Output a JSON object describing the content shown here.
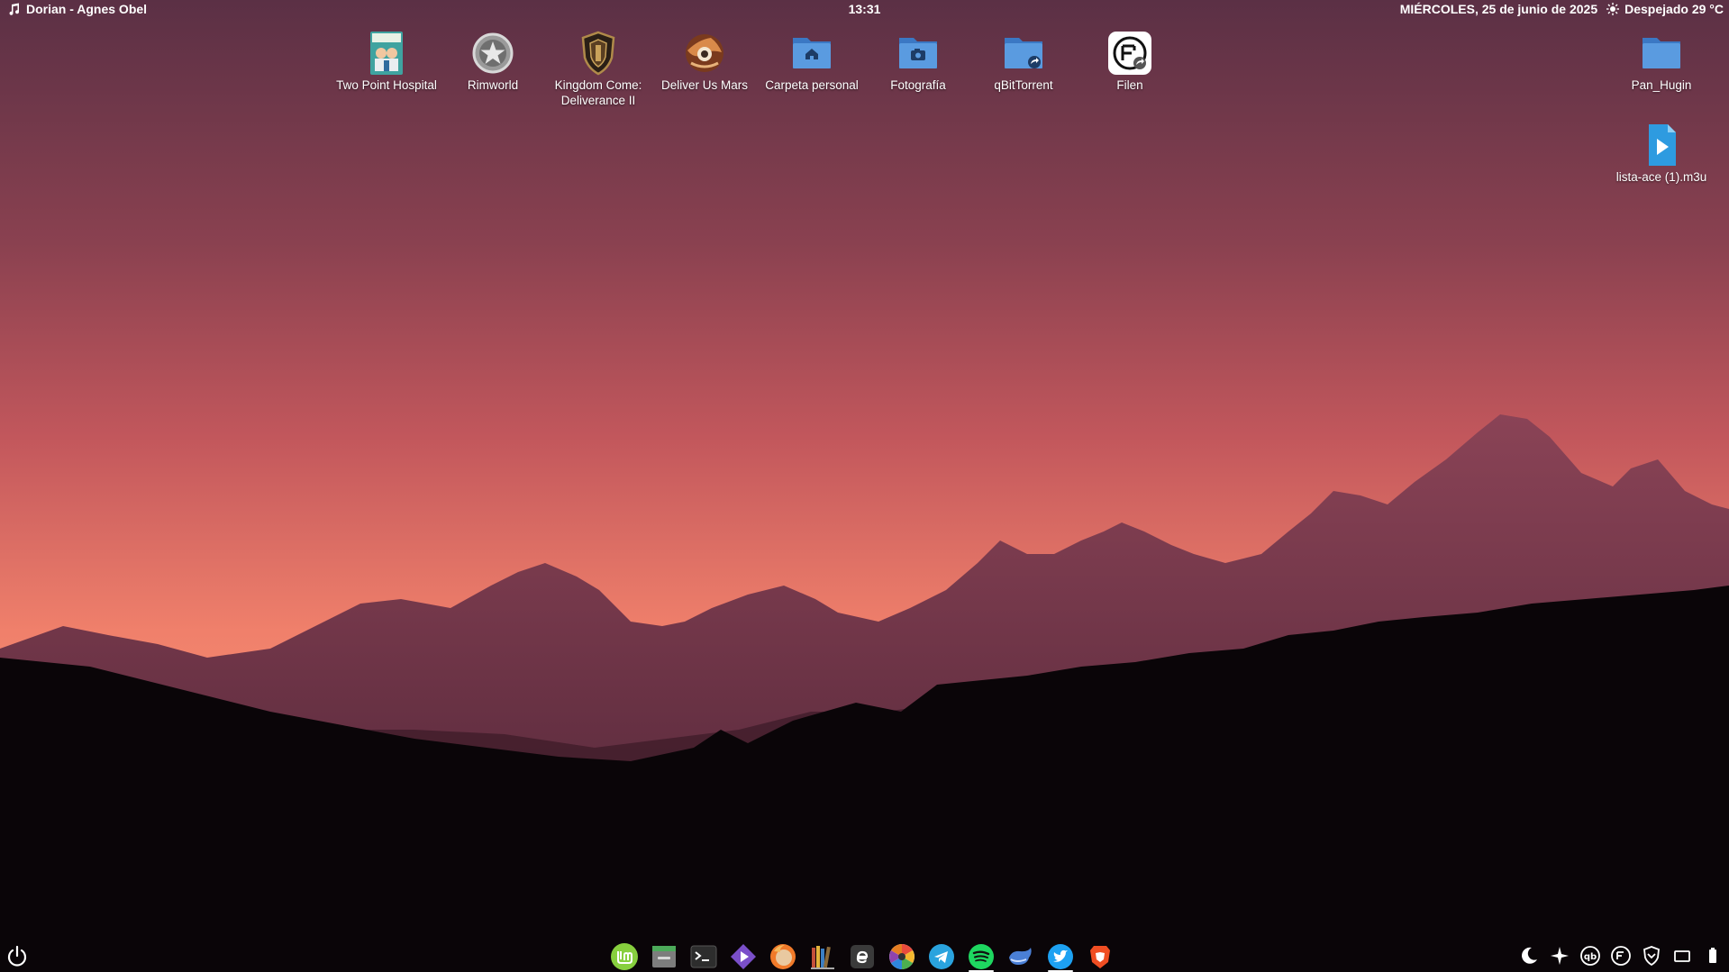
{
  "topbar": {
    "now_playing": "Dorian - Agnes Obel",
    "clock": "13:31",
    "date": "MIÉRCOLES, 25 de junio de 2025",
    "weather": "Despejado 29 °C"
  },
  "desktop_icons": [
    {
      "label": "Two Point Hospital",
      "icon": "game-cover-icon"
    },
    {
      "label": "Rimworld",
      "icon": "rimworld-star-icon"
    },
    {
      "label": "Kingdom Come: Deliverance II",
      "icon": "shield-crest-icon"
    },
    {
      "label": "Deliver Us Mars",
      "icon": "deliver-us-mars-icon"
    },
    {
      "label": "Carpeta personal",
      "icon": "home-folder-icon"
    },
    {
      "label": "Fotografía",
      "icon": "camera-folder-icon"
    },
    {
      "label": "qBitTorrent",
      "icon": "shared-folder-icon"
    },
    {
      "label": "Filen",
      "icon": "filen-icon"
    },
    {
      "label": "Pan_Hugin",
      "icon": "folder-icon"
    },
    {
      "label": "lista-ace (1).m3u",
      "icon": "playlist-file-icon"
    }
  ],
  "dock": [
    "linux-mint-icon",
    "files-icon",
    "terminal-icon",
    "media-player-icon",
    "firefox-icon",
    "library-icon",
    "ebook-icon",
    "photos-icon",
    "telegram-icon",
    "spotify-icon",
    "whale-icon",
    "twitter-icon",
    "brave-icon"
  ],
  "tray": [
    "night-mode-icon",
    "brightness-icon",
    "qbittorrent-tray-icon",
    "filen-tray-icon",
    "vpn-shield-icon",
    "screen-icon",
    "battery-icon"
  ],
  "colors": {
    "sky_top": "#5e3246",
    "sky_bottom": "#f2826a",
    "mountains": "#6b2e46",
    "folder_blue": "#4a8fd6"
  }
}
